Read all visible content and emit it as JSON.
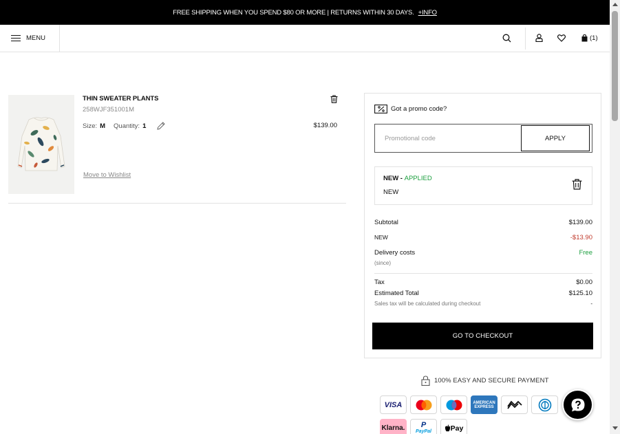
{
  "banner": {
    "text": "FREE SHIPPING WHEN YOU SPEND $80 OR MORE |  RETURNS WITHIN 30 DAYS.",
    "link": "+INFO"
  },
  "header": {
    "menu_label": "MENU",
    "cart_count": "(1)",
    "icons": [
      "search-icon",
      "user-icon",
      "heart-icon",
      "bag-icon"
    ]
  },
  "cart_item": {
    "name": "THIN SWEATER PLANTS",
    "ref": "258WJF351001M",
    "size_label": "Size:",
    "size_value": "M",
    "qty_label": "Quantity:",
    "qty_value": "1",
    "price": "$139.00",
    "wishlist_link": "Move to Wishlist"
  },
  "summary": {
    "promo_heading": "Got a promo code?",
    "promo_placeholder": "Promotional code",
    "apply_label": "APPLY",
    "applied": {
      "code_title": "NEW",
      "status": "APPLIED",
      "code": "NEW"
    },
    "rows": {
      "subtotal_label": "Subtotal",
      "subtotal_value": "$139.00",
      "discount_label": "NEW",
      "discount_value": "-$13.90",
      "delivery_label": "Delivery costs",
      "delivery_value": "Free",
      "delivery_note": "(since)",
      "tax_label": "Tax",
      "tax_value": "$0.00",
      "total_label": "Estimated Total",
      "total_value": "$125.10",
      "note_label": "Sales tax will be calculated during checkout",
      "note_value": "-"
    },
    "checkout_label": "GO TO CHECKOUT"
  },
  "payment": {
    "secure_text": "100% EASY AND SECURE PAYMENT",
    "methods": {
      "visa": "VISA",
      "amex": "AMERICAN EXPRESS",
      "klarna": "Klarna.",
      "paypal_p": "P",
      "paypal": "PayPal",
      "applepay": "Pay"
    }
  },
  "colors": {
    "accent_green": "#1a9e3d",
    "discount_red": "#c0392b",
    "primary": "#000000"
  }
}
